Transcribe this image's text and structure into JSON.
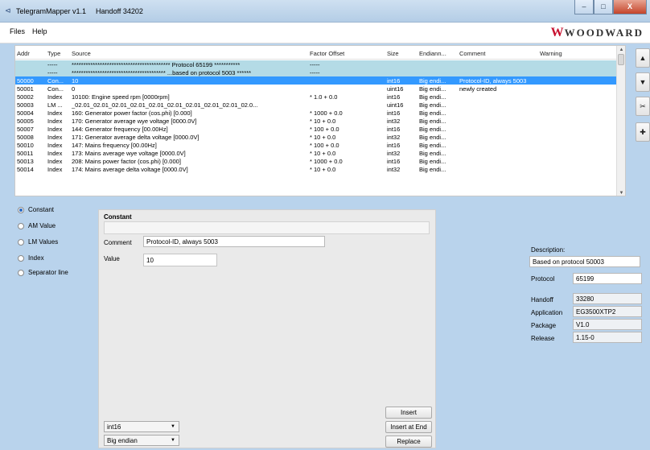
{
  "window": {
    "title": "TelegramMapper v1.1",
    "handoff": "Handoff 34202",
    "minimize": "–",
    "maximize": "□",
    "close": "X"
  },
  "menu": {
    "items": [
      "Files",
      "Help"
    ]
  },
  "logo": {
    "mark": "W",
    "word": "WOODWARD",
    "color": "#c8102e"
  },
  "grid": {
    "columns": [
      "Addr",
      "Type",
      "Source",
      "Factor Offset",
      "Size",
      "Endiann...",
      "Comment",
      "Warning"
    ],
    "rows": [
      {
        "addr": "",
        "type": "-----",
        "source": "****************************************** Protocol 65199 ***********",
        "factor": "-----",
        "size": "",
        "endian": "",
        "comment": "",
        "warning": "",
        "kind": "sep"
      },
      {
        "addr": "",
        "type": "-----",
        "source": "**************************************** ...based on protocol 5003 ******",
        "factor": "-----",
        "size": "",
        "endian": "",
        "comment": "",
        "warning": "",
        "kind": "sep"
      },
      {
        "addr": "50000",
        "type": "Con...",
        "source": "10",
        "factor": "",
        "size": "int16",
        "endian": "Big endi...",
        "comment": "Protocol-ID, always 5003",
        "warning": "",
        "kind": "sel"
      },
      {
        "addr": "50001",
        "type": "Con...",
        "source": "0",
        "factor": "",
        "size": "uint16",
        "endian": "Big endi...",
        "comment": "newly created",
        "warning": "",
        "kind": ""
      },
      {
        "addr": "50002",
        "type": "Index",
        "source": "10100: Engine speed rpm [0000rpm]",
        "factor": "* 1.0 + 0.0",
        "size": "int16",
        "endian": "Big endi...",
        "comment": "",
        "warning": "",
        "kind": ""
      },
      {
        "addr": "50003",
        "type": "LM ...",
        "source": "_02.01_02.01_02.01_02.01_02.01_02.01_02.01_02.01_02.01_02.0...",
        "factor": "",
        "size": "uint16",
        "endian": "Big endi...",
        "comment": "",
        "warning": "",
        "kind": ""
      },
      {
        "addr": "50004",
        "type": "Index",
        "source": "160: Generator power factor (cos.phi) [0.000]",
        "factor": "* 1000 + 0.0",
        "size": "int16",
        "endian": "Big endi...",
        "comment": "",
        "warning": "",
        "kind": ""
      },
      {
        "addr": "50005",
        "type": "Index",
        "source": "170: Generator average wye voltage [0000.0V]",
        "factor": "* 10 + 0.0",
        "size": "int32",
        "endian": "Big endi...",
        "comment": "",
        "warning": "",
        "kind": ""
      },
      {
        "addr": "50007",
        "type": "Index",
        "source": "144: Generator frequency [00.00Hz]",
        "factor": "* 100 + 0.0",
        "size": "int16",
        "endian": "Big endi...",
        "comment": "",
        "warning": "",
        "kind": ""
      },
      {
        "addr": "50008",
        "type": "Index",
        "source": "171: Generator average delta voltage [0000.0V]",
        "factor": "* 10 + 0.0",
        "size": "int32",
        "endian": "Big endi...",
        "comment": "",
        "warning": "",
        "kind": ""
      },
      {
        "addr": "50010",
        "type": "Index",
        "source": "147: Mains frequency [00.00Hz]",
        "factor": "* 100 + 0.0",
        "size": "int16",
        "endian": "Big endi...",
        "comment": "",
        "warning": "",
        "kind": ""
      },
      {
        "addr": "50011",
        "type": "Index",
        "source": "173: Mains average wye voltage [0000.0V]",
        "factor": "* 10 + 0.0",
        "size": "int32",
        "endian": "Big endi...",
        "comment": "",
        "warning": "",
        "kind": ""
      },
      {
        "addr": "50013",
        "type": "Index",
        "source": "208: Mains power factor (cos.phi) [0.000]",
        "factor": "* 1000 + 0.0",
        "size": "int16",
        "endian": "Big endi...",
        "comment": "",
        "warning": "",
        "kind": ""
      },
      {
        "addr": "50014",
        "type": "Index",
        "source": "174: Mains average delta voltage [0000.0V]",
        "factor": "* 10 + 0.0",
        "size": "int32",
        "endian": "Big endi...",
        "comment": "",
        "warning": "",
        "kind": ""
      }
    ]
  },
  "tools": {
    "up": "▲",
    "down": "▼",
    "cut": "✂",
    "add": "✚"
  },
  "source_types": [
    {
      "label": "Constant",
      "checked": true
    },
    {
      "label": "AM Value",
      "checked": false
    },
    {
      "label": "LM Values",
      "checked": false
    },
    {
      "label": "Index",
      "checked": false
    },
    {
      "label": "Separator line",
      "checked": false
    }
  ],
  "constant_panel": {
    "title": "Constant",
    "comment_label": "Comment",
    "comment_value": "Protocol-ID, always 5003",
    "value_label": "Value",
    "value": "10",
    "insert": "Insert",
    "insert_end": "Insert at End",
    "replace": "Replace",
    "size_select": "int16",
    "endian_select": "Big endian"
  },
  "info": {
    "description_label": "Description:",
    "description": "Based on protocol 50003",
    "protocol_label": "Protocol",
    "protocol": "65199",
    "handoff_label": "Handoff",
    "handoff": "33280",
    "application_label": "Application",
    "application": "EG3500XTP2",
    "package_label": "Package",
    "package": "V1.0",
    "release_label": "Release",
    "release": "1.15-0"
  }
}
